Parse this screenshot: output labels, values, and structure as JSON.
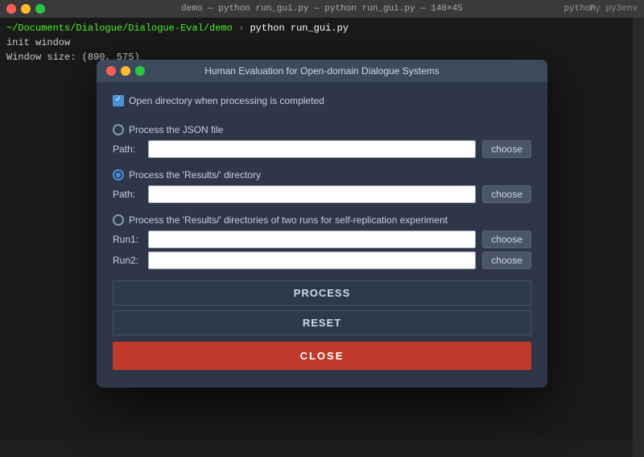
{
  "window": {
    "title": "demo — python run_gui.py — python run_gui.py — 140×45",
    "py_label": "python",
    "py_version": "Py py3env"
  },
  "terminal": {
    "prompt": "~/Documents/Dialogue/Dialogue-Eval/demo",
    "arrow": "›",
    "command": "python run_gui.py",
    "line1": "init window",
    "line2": "Window size: (890, 575)"
  },
  "dialog": {
    "title": "Human Evaluation for Open-domain Dialogue Systems",
    "checkbox_label": "Open directory when processing is completed",
    "radio1_label": "Process the JSON file",
    "radio1_path_label": "Path:",
    "radio2_label": "Process the 'Results/' directory",
    "radio2_path_label": "Path:",
    "radio3_label": "Process the 'Results/' directories of two runs for self-replication experiment",
    "run1_label": "Run1:",
    "run2_label": "Run2:",
    "choose_label": "choose",
    "process_label": "PROCESS",
    "reset_label": "RESET",
    "close_label": "CLOSE"
  }
}
